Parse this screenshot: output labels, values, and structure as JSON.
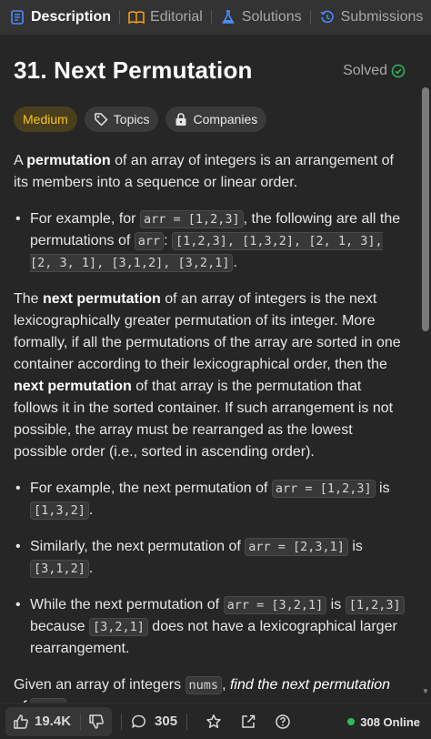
{
  "tabs": [
    {
      "label": "Description",
      "icon": "description-icon",
      "active": true
    },
    {
      "label": "Editorial",
      "icon": "book-icon",
      "active": false
    },
    {
      "label": "Solutions",
      "icon": "flask-icon",
      "active": false
    },
    {
      "label": "Submissions",
      "icon": "history-icon",
      "active": false
    }
  ],
  "problem": {
    "title": "31. Next Permutation",
    "status": "Solved",
    "difficulty": "Medium",
    "topics_label": "Topics",
    "companies_label": "Companies"
  },
  "description": {
    "p1": {
      "a": "A ",
      "b": "permutation",
      "c": " of an array of integers is an arrangement of its members into a sequence or linear order."
    },
    "b1": {
      "a": "For example, for ",
      "code1": "arr = [1,2,3]",
      "b": ", the following are all the permutations of ",
      "code2": "arr",
      "c": ": ",
      "code3": "[1,2,3], [1,3,2], [2, 1, 3], [2, 3, 1], [3,1,2], [3,2,1]",
      "d": "."
    },
    "p2": {
      "b1": "next permutation",
      "a": " of an array of integers is the next lexicographically greater permutation of its integer. More formally, if all the permutations of the array are sorted in one container according to their lexicographical order, then the ",
      "b2": "next permutation",
      "c": " of that array is the permutation that follows it in the sorted container. If such arrangement is not possible, the array must be rearranged as the lowest possible order (i.e., sorted in ascending order).",
      "prefix": "The "
    },
    "b2": {
      "a": "For example, the next permutation of ",
      "code1": "arr = [1,2,3]",
      "b": " is ",
      "code2": "[1,3,2]",
      "c": "."
    },
    "b3": {
      "a": "Similarly, the next permutation of ",
      "code1": "arr = [2,3,1]",
      "b": " is ",
      "code2": "[3,1,2]",
      "c": "."
    },
    "b4": {
      "a": "While the next permutation of ",
      "code1": "arr = [3,2,1]",
      "b": " is ",
      "code2": "[1,2,3]",
      "c": " because ",
      "code3": "[3,2,1]",
      "d": " does not have a lexicographical larger rearrangement."
    },
    "p3": {
      "a": "Given an array of integers ",
      "code1": "nums",
      "b": ", ",
      "i": "find the next permutation of",
      "code2": "nums",
      "c": "."
    }
  },
  "footer": {
    "likes": "19.4K",
    "comments": "305",
    "online": "308 Online"
  },
  "colors": {
    "accent_medium": "#ffc01e",
    "solved_green": "#2cbb5d",
    "online_dot": "#2cbb5d"
  }
}
